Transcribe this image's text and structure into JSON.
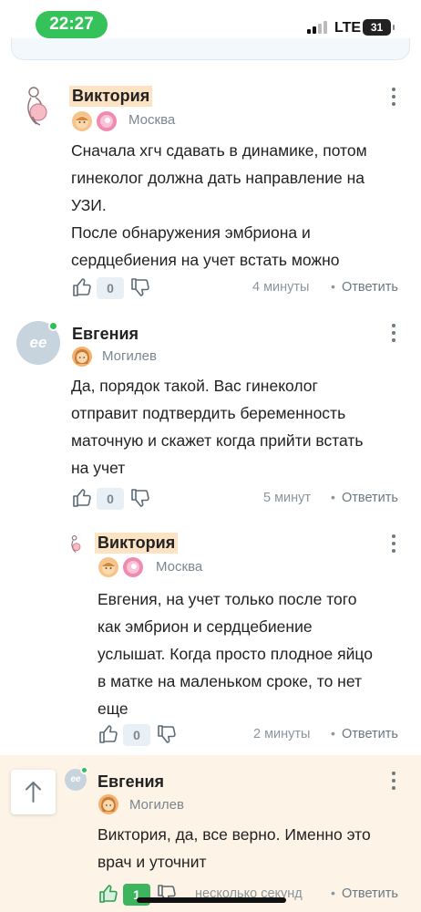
{
  "status_bar": {
    "time": "22:27",
    "network": "LTE",
    "battery": "31"
  },
  "comments": [
    {
      "author": "Виктория",
      "city": "Москва",
      "lines": [
        "Сначала хгч сдавать в динамике, потом",
        "гинеколог должна дать направление на",
        "УЗИ.",
        "После обнаружения эмбриона и",
        "сердцебиения на учет встать можно"
      ],
      "likes": "0",
      "time": "4 минуты",
      "reply": "Ответить"
    },
    {
      "author": "Евгения",
      "avatar_text": "ее",
      "city": "Могилев",
      "lines": [
        "Да, порядок такой. Вас гинеколог",
        "отправит подтвердить беременность",
        "маточную и скажет когда прийти встать",
        "на учет"
      ],
      "likes": "0",
      "time": "5 минут",
      "reply": "Ответить"
    },
    {
      "author": "Виктория",
      "city": "Москва",
      "mention": "Евгения",
      "lines": [
        ", на учет только после того",
        "как эмбрион и сердцебиение",
        "услышат. Когда просто плодное яйцо",
        "в матке на маленьком сроке, то нет",
        "еще"
      ],
      "likes": "0",
      "time": "2 минуты",
      "reply": "Ответить"
    },
    {
      "author": "Евгения",
      "avatar_text": "ее",
      "city": "Могилев",
      "mention": "Виктория",
      "lines": [
        ", да, все верно. Именно это",
        "врач и уточнит"
      ],
      "likes": "1",
      "time": "несколько секунд",
      "reply": "Ответить"
    }
  ],
  "colors": {
    "accent_green": "#35c25a",
    "highlight": "#fdf4e7",
    "name_mark": "#fbe3c4"
  },
  "icons": [
    "more-vertical-icon",
    "thumb-up-icon",
    "thumb-down-icon",
    "arrow-up-icon"
  ]
}
